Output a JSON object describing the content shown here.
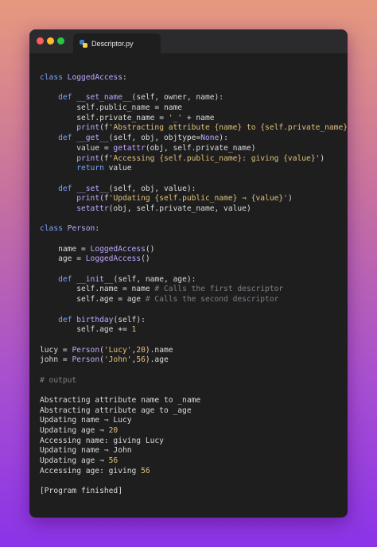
{
  "window": {
    "tab_title": "Descriptor.py",
    "tab_icon": "python-icon"
  },
  "code_lines": [
    "class LoggedAccess:",
    "",
    "    def __set_name__(self, owner, name):",
    "        self.public_name = name",
    "        self.private_name = '_' + name",
    "        print(f'Abstracting attribute {name} to {self.private_name}')",
    "    def __get__(self, obj, objtype=None):",
    "        value = getattr(obj, self.private_name)",
    "        print(f'Accessing {self.public_name}: giving {value}')",
    "        return value",
    "",
    "    def __set__(self, obj, value):",
    "        print(f'Updating {self.public_name} ⇒ {value}')",
    "        setattr(obj, self.private_name, value)",
    "",
    "class Person:",
    "",
    "    name = LoggedAccess()",
    "    age = LoggedAccess()",
    "",
    "    def __init__(self, name, age):",
    "        self.name = name # Calls the first descriptor",
    "        self.age = age # Calls the second descriptor",
    "",
    "    def birthday(self):",
    "        self.age += 1",
    "",
    "lucy = Person('Lucy',20).name",
    "john = Person('John',56).age",
    "",
    "# output",
    "",
    "Abstracting attribute name to _name",
    "Abstracting attribute age to _age",
    "Updating name ⇒ Lucy",
    "Updating age ⇒ 20",
    "Accessing name: giving Lucy",
    "Updating name ⇒ John",
    "Updating age ⇒ 56",
    "Accessing age: giving 56",
    "",
    "[Program finished]"
  ],
  "colors": {
    "keyword": "#7aa2f7",
    "function": "#c0a7ff",
    "operator": "#c678dd",
    "string": "#e0c27a",
    "comment": "#7f7f85",
    "background": "#1e1e1f"
  }
}
